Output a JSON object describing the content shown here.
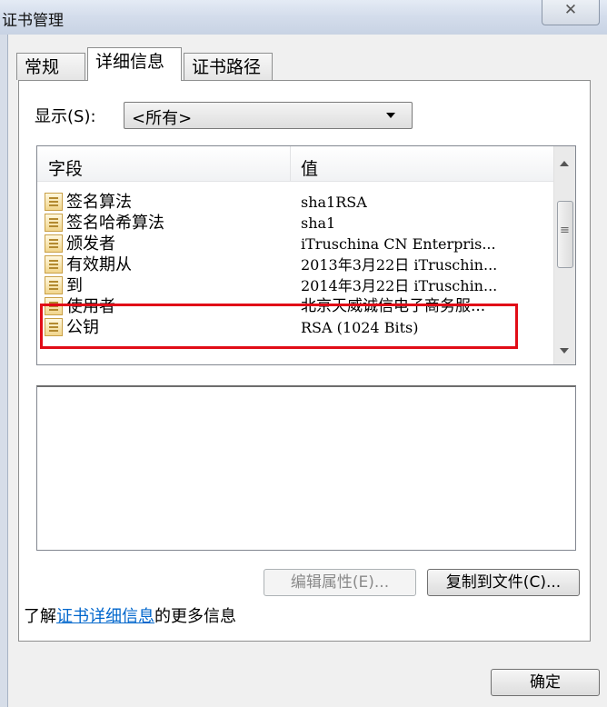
{
  "window": {
    "title": "证书管理",
    "close_symbol": "✕"
  },
  "tabs": [
    {
      "label": "常规",
      "active": false
    },
    {
      "label": "详细信息",
      "active": true
    },
    {
      "label": "证书路径",
      "active": false
    }
  ],
  "show": {
    "label": "显示(S):",
    "selected": "<所有>"
  },
  "list": {
    "headers": {
      "field": "字段",
      "value": "值"
    },
    "rows": [
      {
        "field": "签名算法",
        "value": "sha1RSA"
      },
      {
        "field": "签名哈希算法",
        "value": "sha1"
      },
      {
        "field": "颁发者",
        "value": "iTruschina CN Enterpris..."
      },
      {
        "field": "有效期从",
        "value": "2013年3月22日 iTruschin..."
      },
      {
        "field": "到",
        "value": "2014年3月22日 iTruschin..."
      },
      {
        "field": "使用者",
        "value": "北京天威诚信电子商务服..."
      },
      {
        "field": "公钥",
        "value": "RSA (1024 Bits)"
      }
    ]
  },
  "buttons": {
    "edit_properties": "编辑属性(E)...",
    "copy_to_file": "复制到文件(C)...",
    "ok": "确定"
  },
  "learn_more": {
    "prefix": "了解",
    "link": "证书详细信息",
    "suffix": "的更多信息"
  },
  "colors": {
    "highlight": "#e10c17",
    "link": "#0066cc"
  }
}
